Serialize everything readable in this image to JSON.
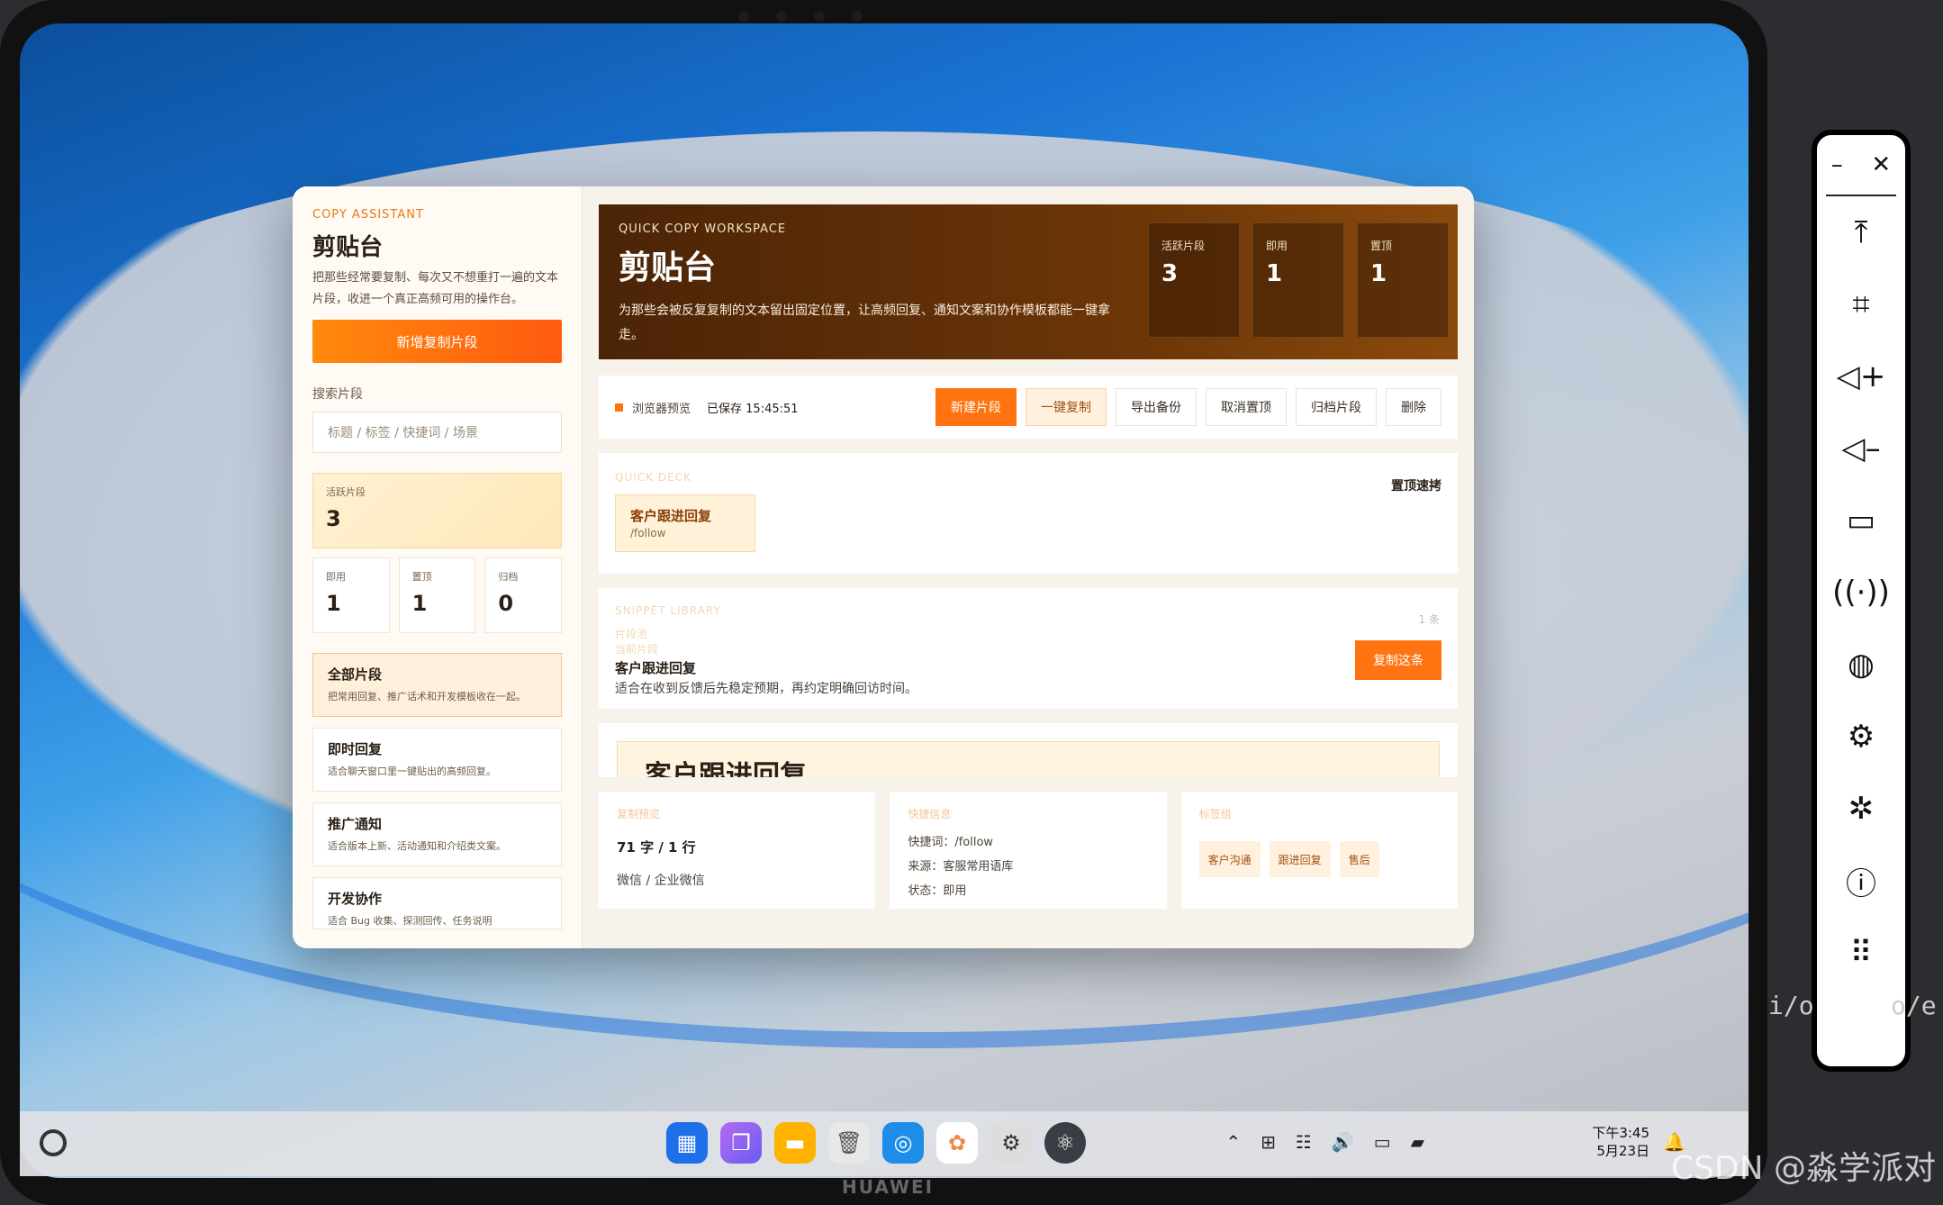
{
  "sidebar": {
    "eyebrow": "COPY ASSISTANT",
    "title": "剪贴台",
    "desc": "把那些经常要复制、每次又不想重打一遍的文本片段，收进一个真正高频可用的操作台。",
    "add_button": "新增复制片段",
    "search_label": "搜索片段",
    "search_placeholder": "标题 / 标签 / 快捷词 / 场景",
    "active_stat": {
      "label": "活跃片段",
      "value": "3"
    },
    "small_stats": [
      {
        "label": "即用",
        "value": "1"
      },
      {
        "label": "置顶",
        "value": "1"
      },
      {
        "label": "归档",
        "value": "0"
      }
    ],
    "categories": [
      {
        "title": "全部片段",
        "desc": "把常用回复、推广话术和开发模板收在一起。"
      },
      {
        "title": "即时回复",
        "desc": "适合聊天窗口里一键贴出的高频回复。"
      },
      {
        "title": "推广通知",
        "desc": "适合版本上新、活动通知和介绍类文案。"
      },
      {
        "title": "开发协作",
        "desc": "适合 Bug 收集、探测回传、任务说明"
      }
    ]
  },
  "hero": {
    "eyebrow": "QUICK COPY WORKSPACE",
    "title": "剪贴台",
    "desc": "为那些会被反复复制的文本留出固定位置，让高频回复、通知文案和协作模板都能一键拿走。",
    "stats": [
      {
        "label": "活跃片段",
        "value": "3"
      },
      {
        "label": "即用",
        "value": "1"
      },
      {
        "label": "置顶",
        "value": "1"
      }
    ]
  },
  "toolbar": {
    "mode": "浏览器预览",
    "saved": "已保存 15:45:51",
    "buttons": [
      "新建片段",
      "一键复制",
      "导出备份",
      "取消置顶",
      "归档片段",
      "删除"
    ]
  },
  "deck": {
    "eyebrow": "QUICK DECK",
    "right": "置顶速拷",
    "chip_title": "客户跟进回复",
    "chip_sub": "/follow"
  },
  "library": {
    "eyebrow": "SNIPPET LIBRARY",
    "count": "1 条",
    "ghost_a": "片段池",
    "ghost_b": "当前片段",
    "item_title": "客户跟进回复",
    "item_desc": "适合在收到反馈后先稳定预期，再约定明确回访时间。",
    "copy_button": "复制这条"
  },
  "preview": {
    "heading": "客户跟进回复"
  },
  "cards": {
    "preview": {
      "ghost": "复制预览",
      "main": "71 字 / 1 行",
      "sub": "微信 / 企业微信"
    },
    "info": {
      "ghost": "快捷信息",
      "shortcut": "快捷词：/follow",
      "source": "来源：客服常用语库",
      "status": "状态：即用"
    },
    "tags": {
      "ghost": "标签组",
      "items": [
        "客户沟通",
        "跟进回复",
        "售后"
      ]
    }
  },
  "taskbar": {
    "time": "下午3:45",
    "date": "5月23日"
  },
  "device": {
    "brand": "HUAWEI"
  },
  "watermark": "CSDN @淼学派对",
  "code_fragments": [
    "i/o",
    "o/e"
  ],
  "colors": {
    "accent": "#ff7410",
    "hero_bg": "#5a2c08",
    "panel_bg": "#fffaf3"
  }
}
